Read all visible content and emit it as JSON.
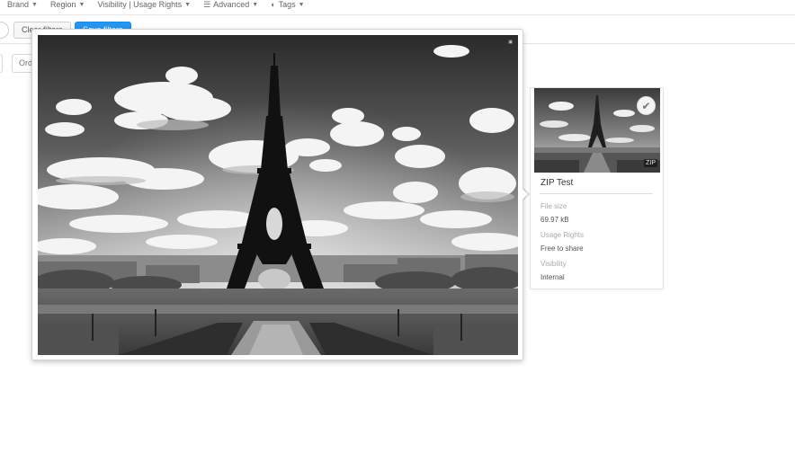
{
  "filters": [
    {
      "label": "Brand",
      "icon": "caret-down-icon"
    },
    {
      "label": "Region",
      "icon": "caret-down-icon"
    },
    {
      "label": "Visibility | Usage Rights",
      "icon": "caret-down-icon"
    },
    {
      "label": "Advanced",
      "icon": "sliders-icon"
    },
    {
      "label": "Tags",
      "icon": "toggle-icon"
    }
  ],
  "actions": {
    "clear_label": "Clear filters",
    "save_label": "Save filters"
  },
  "sort": {
    "order_label": "Ord"
  },
  "asset": {
    "title": "ZIP Test",
    "badge": "ZIP",
    "file_size_label": "File size",
    "file_size_value": "69.97 kB",
    "usage_rights_label": "Usage Rights",
    "usage_rights_value": "Free to share",
    "visibility_label": "Visibility",
    "visibility_value": "Internal"
  },
  "colors": {
    "primary_button": "#2196f3",
    "border": "#e3e3e3"
  }
}
